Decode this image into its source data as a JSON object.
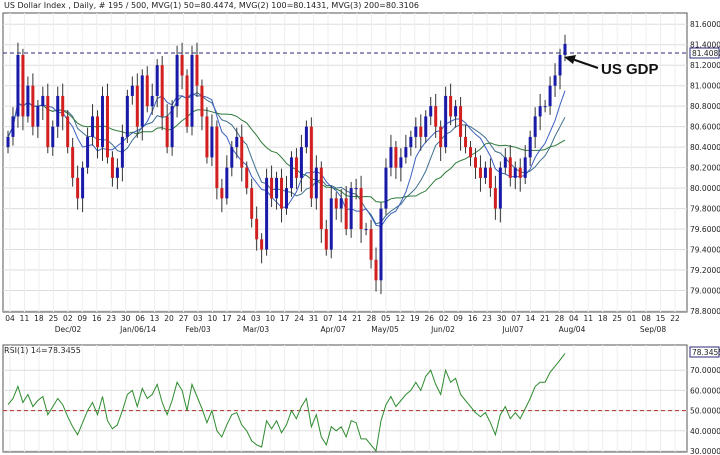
{
  "header": {
    "title": "US Dollar Index , Daily, # 195 / 500, MVG(1) 50=80.4474, MVG(2) 100=80.1431, MVG(3) 200=80.3106"
  },
  "annotation": {
    "label": "US GDP"
  },
  "colors": {
    "up_bar": "#1a1aa8",
    "down_bar": "#d21f1f",
    "mvg50": "#3a5fbf",
    "mvg100": "#2f7a3a",
    "mvg200": "#3e6f8e",
    "rsi": "#2e8b2e",
    "rsi_mid": "#b03030",
    "price_line": "#1a1a6a"
  },
  "chart_data": [
    {
      "type": "candlestick",
      "title": "US Dollar Index , Daily, # 195 / 500, MVG(1) 50=80.4474, MVG(2) 100=80.1431, MVG(3) 200=80.3106",
      "ylim": [
        78.8,
        81.7
      ],
      "y_ticks": [
        "81.6000",
        "81.4000",
        "81.2000",
        "81.0000",
        "80.8000",
        "80.6000",
        "80.4000",
        "80.2000",
        "80.0000",
        "79.8000",
        "79.6000",
        "79.4000",
        "79.2000",
        "79.0000",
        "78.8000"
      ],
      "last_price_label": "81.4080",
      "last_price": 81.408,
      "x_day_ticks": [
        "04",
        "11",
        "18",
        "25",
        "02",
        "09",
        "16",
        "23",
        "30",
        "06",
        "13",
        "20",
        "27",
        "03",
        "10",
        "17",
        "24",
        "03",
        "10",
        "17",
        "24",
        "31",
        "07",
        "14",
        "21",
        "28",
        "05",
        "12",
        "19",
        "26",
        "02",
        "09",
        "16",
        "23",
        "30",
        "07",
        "14",
        "21",
        "28",
        "04",
        "11",
        "18",
        "25",
        "01",
        "08",
        "15",
        "22"
      ],
      "x_month_ticks": [
        "Dec/02",
        "Jan/06/14",
        "Feb/03",
        "Mar/03",
        "Apr/07",
        "May/05",
        "Jun/02",
        "Jul/07",
        "Aug/04",
        "Sep/08"
      ],
      "close": [
        80.5,
        80.7,
        81.3,
        80.7,
        81.0,
        80.6,
        80.8,
        80.9,
        80.4,
        80.6,
        80.9,
        80.7,
        80.4,
        80.1,
        79.9,
        80.2,
        80.5,
        80.7,
        80.4,
        80.9,
        80.3,
        80.1,
        80.2,
        80.5,
        80.9,
        81.0,
        80.6,
        81.1,
        80.8,
        80.9,
        81.2,
        80.7,
        80.4,
        80.8,
        81.3,
        81.1,
        80.6,
        81.3,
        81.0,
        80.7,
        80.3,
        80.6,
        80.0,
        79.9,
        80.2,
        80.4,
        80.5,
        80.2,
        80.0,
        79.7,
        79.5,
        79.4,
        80.1,
        79.9,
        80.1,
        79.8,
        80.0,
        80.3,
        80.1,
        80.4,
        80.6,
        79.9,
        80.2,
        79.6,
        79.4,
        79.9,
        79.8,
        79.9,
        79.6,
        80.0,
        80.0,
        79.6,
        79.6,
        79.3,
        79.1,
        79.8,
        80.2,
        80.4,
        80.2,
        80.3,
        80.4,
        80.5,
        80.6,
        80.5,
        80.7,
        80.8,
        80.6,
        80.4,
        80.9,
        80.7,
        80.8,
        80.5,
        80.4,
        80.3,
        80.2,
        80.1,
        80.2,
        80.0,
        79.8,
        80.2,
        80.3,
        80.1,
        80.2,
        80.1,
        80.3,
        80.5,
        80.7,
        80.8,
        80.8,
        81.0,
        81.1,
        81.3,
        81.408
      ],
      "rsi": {
        "name": "RSI(1) 14=78.3455",
        "last_value_label": "78.3455",
        "last_value": 78.3455,
        "ylim": [
          30,
          82
        ],
        "y_ticks": [
          "70.0000",
          "60.0000",
          "50.0000",
          "40.0000",
          "30.0000"
        ],
        "reference_level": 50,
        "values": [
          53,
          56,
          62,
          54,
          58,
          52,
          55,
          57,
          48,
          52,
          56,
          53,
          47,
          42,
          38,
          44,
          50,
          54,
          48,
          57,
          45,
          41,
          43,
          50,
          58,
          60,
          52,
          61,
          56,
          58,
          63,
          54,
          48,
          55,
          64,
          60,
          50,
          63,
          57,
          51,
          44,
          50,
          40,
          37,
          43,
          48,
          49,
          43,
          40,
          35,
          33,
          32,
          45,
          41,
          45,
          39,
          43,
          50,
          46,
          52,
          56,
          42,
          48,
          37,
          33,
          42,
          40,
          42,
          37,
          45,
          44,
          36,
          36,
          33,
          30,
          45,
          53,
          57,
          52,
          55,
          58,
          60,
          64,
          60,
          67,
          70,
          63,
          58,
          70,
          64,
          66,
          58,
          55,
          52,
          49,
          47,
          49,
          44,
          38,
          48,
          52,
          46,
          49,
          46,
          51,
          56,
          62,
          64,
          64,
          69,
          72,
          75,
          78.3455
        ]
      }
    }
  ]
}
